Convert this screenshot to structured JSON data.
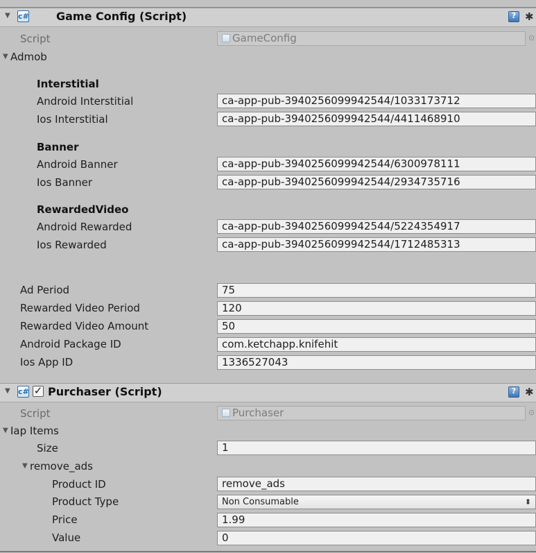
{
  "game_config": {
    "title": "Game Config (Script)",
    "script_label": "Script",
    "script_value": "GameConfig",
    "admob_label": "Admob",
    "interstitial_header": "Interstitial",
    "android_interstitial_label": "Android Interstitial",
    "android_interstitial_value": "ca-app-pub-3940256099942544/1033173712",
    "ios_interstitial_label": "Ios Interstitial",
    "ios_interstitial_value": "ca-app-pub-3940256099942544/4411468910",
    "banner_header": "Banner",
    "android_banner_label": "Android Banner",
    "android_banner_value": "ca-app-pub-3940256099942544/6300978111",
    "ios_banner_label": "Ios Banner",
    "ios_banner_value": "ca-app-pub-3940256099942544/2934735716",
    "rewarded_header": "RewardedVideo",
    "android_rewarded_label": "Android Rewarded",
    "android_rewarded_value": "ca-app-pub-3940256099942544/5224354917",
    "ios_rewarded_label": "Ios Rewarded",
    "ios_rewarded_value": "ca-app-pub-3940256099942544/1712485313",
    "ad_period_label": "Ad Period",
    "ad_period_value": "75",
    "rv_period_label": "Rewarded Video Period",
    "rv_period_value": "120",
    "rv_amount_label": "Rewarded Video Amount",
    "rv_amount_value": "50",
    "android_pkg_label": "Android Package ID",
    "android_pkg_value": "com.ketchapp.knifehit",
    "ios_app_label": "Ios App ID",
    "ios_app_value": "1336527043"
  },
  "purchaser": {
    "title": "Purchaser (Script)",
    "script_label": "Script",
    "script_value": "Purchaser",
    "iap_items_label": "Iap Items",
    "size_label": "Size",
    "size_value": "1",
    "item_label": "remove_ads",
    "product_id_label": "Product ID",
    "product_id_value": "remove_ads",
    "product_type_label": "Product Type",
    "product_type_value": "Non Consumable",
    "price_label": "Price",
    "price_value": "1.99",
    "value_label": "Value",
    "value_value": "0"
  },
  "icons": {
    "fold_open": "▼",
    "script": "c#",
    "check": "✓",
    "help": "?",
    "gear": "✱",
    "object_picker": "⊙",
    "dropdown": "⬍"
  },
  "colors": {
    "panel": "#c2c2c2",
    "header": "#d0d0d0",
    "field": "#f0f0f0",
    "readonly_field": "#cbcbcb"
  }
}
